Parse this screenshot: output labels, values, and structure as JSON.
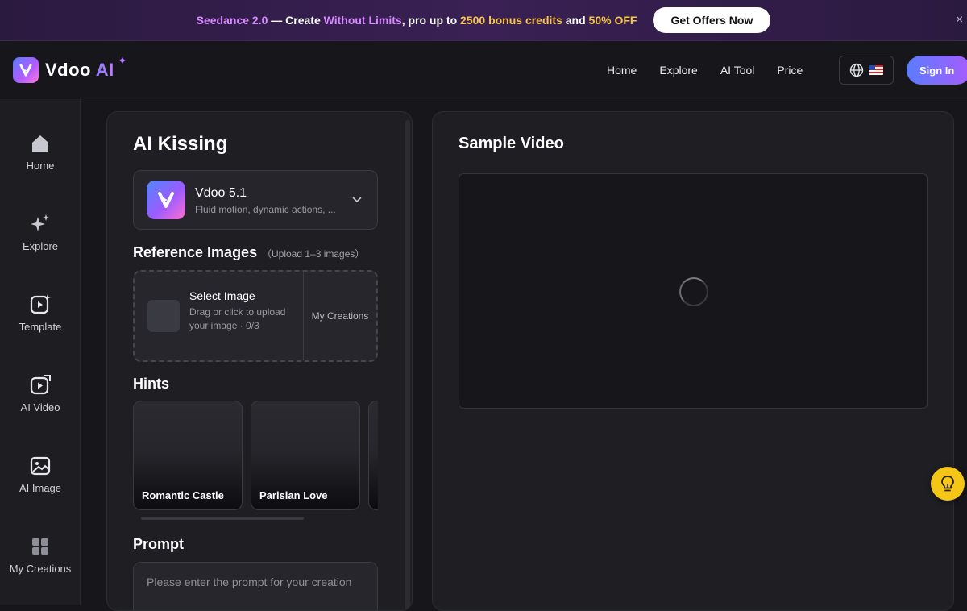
{
  "promo": {
    "part1": "Seedance 2.0",
    "part2": " — Create ",
    "part3": "Without Limits",
    "part4": ", pro up to ",
    "part5": "2500 bonus credits",
    "part6": " and ",
    "part7": "50% OFF",
    "button": "Get Offers Now",
    "close": "×"
  },
  "header": {
    "logo_main": "Vdoo ",
    "logo_ai": "AI",
    "nav": [
      "Home",
      "Explore",
      "AI Tool",
      "Price"
    ],
    "sign_in": "Sign In"
  },
  "sidebar": {
    "items": [
      {
        "label": "Home",
        "icon": "home-icon"
      },
      {
        "label": "Explore",
        "icon": "sparkle-icon"
      },
      {
        "label": "Template",
        "icon": "template-icon"
      },
      {
        "label": "AI Video",
        "icon": "video-icon"
      },
      {
        "label": "AI Image",
        "icon": "image-icon"
      },
      {
        "label": "My Creations",
        "icon": "grid-icon"
      }
    ]
  },
  "panel": {
    "title": "AI Kissing",
    "model": {
      "name": "Vdoo 5.1",
      "description": "Fluid motion, dynamic actions, ..."
    },
    "reference": {
      "title": "Reference Images",
      "note": "（Upload 1–3 images）",
      "upload_title": "Select Image",
      "upload_desc": "Drag or click to upload your image · 0/3",
      "my_creations": "My Creations"
    },
    "hints": {
      "title": "Hints",
      "items": [
        "Romantic Castle",
        "Parisian Love",
        ""
      ]
    },
    "prompt": {
      "title": "Prompt",
      "placeholder": "Please enter the prompt for your creation"
    }
  },
  "sample": {
    "title": "Sample Video"
  },
  "colors": {
    "accent_purple": "#d68bff",
    "accent_gold": "#f7c64d",
    "signin_gradient_start": "#5b7cff",
    "signin_gradient_end": "#a65cff",
    "fab_yellow": "#f5c518"
  }
}
